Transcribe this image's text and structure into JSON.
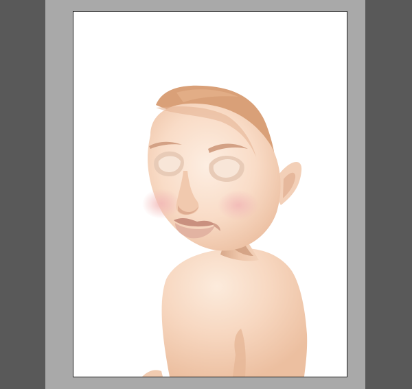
{
  "canvas": {
    "workspace_color": "#595959",
    "pasteboard_color": "#a9a9a9",
    "artboard_color": "#ffffff",
    "artboard_border_color": "#1a1a1a"
  },
  "artwork": {
    "subject": "illustrated-woman-looking-over-shoulder",
    "colors": {
      "skin_light": "#fbe4d3",
      "skin_mid": "#f4cdb1",
      "skin_shadow": "#e3b193",
      "hair": "#d9a078",
      "hair_dark": "#c98a62",
      "blush": "#f3c0bd",
      "lips": "#d9a79b",
      "eye_socket": "#ead0bd"
    }
  }
}
